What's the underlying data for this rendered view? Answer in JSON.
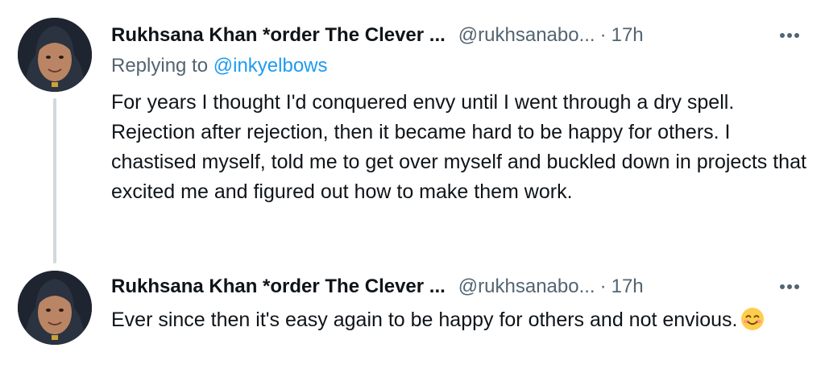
{
  "thread": [
    {
      "author_name": "Rukhsana Khan *order The Clever ...",
      "handle": "@rukhsanabo...",
      "separator": "·",
      "time": "17h",
      "replying_prefix": "Replying to",
      "replying_to": "@inkyelbows",
      "text": "For years I thought I'd conquered envy until I went through a dry spell. Rejection after rejection, then it became hard to be happy for others. I chastised myself, told me to get over myself and buckled down in projects that excited me and figured out how to make them work."
    },
    {
      "author_name": "Rukhsana Khan *order The Clever ...",
      "handle": "@rukhsanabo...",
      "separator": "·",
      "time": "17h",
      "text": "Ever since then it's easy again to be happy for others and not envious.",
      "emoji": "smiling-face-with-smiling-eyes"
    }
  ],
  "colors": {
    "text_primary": "#0f1419",
    "text_secondary": "#536471",
    "link": "#1d9bf0",
    "thread_line": "#cfd9de",
    "background": "#ffffff"
  },
  "icons": {
    "more": "more-horizontal-icon",
    "emoji": "smiling-face-emoji"
  }
}
